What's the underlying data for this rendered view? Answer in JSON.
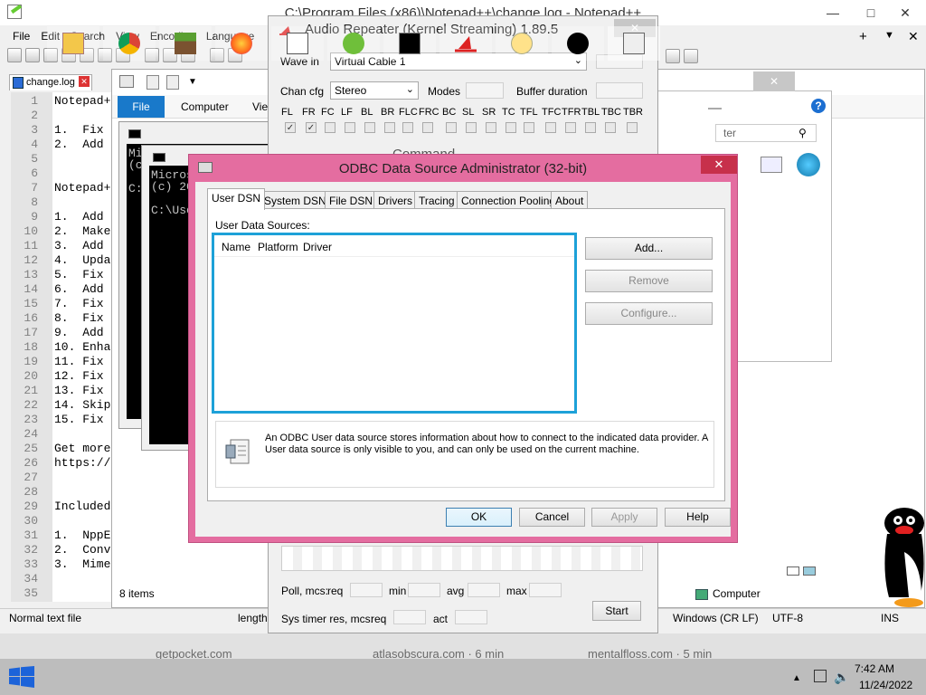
{
  "notepad": {
    "title": "C:\\Program Files (x86)\\Notepad++\\change.log - Notepad++",
    "menus": [
      "File",
      "Edit",
      "Search",
      "View",
      "Encoding",
      "Language"
    ],
    "tab": "change.log",
    "lines": [
      {
        "n": "1",
        "t": "Notepad++"
      },
      {
        "n": "2",
        "t": ""
      },
      {
        "n": "3",
        "t": "1.  Fix"
      },
      {
        "n": "4",
        "t": "2.  Add"
      },
      {
        "n": "5",
        "t": ""
      },
      {
        "n": "6",
        "t": ""
      },
      {
        "n": "7",
        "t": "Notepad++"
      },
      {
        "n": "8",
        "t": ""
      },
      {
        "n": "9",
        "t": "1.  Add"
      },
      {
        "n": "10",
        "t": "2.  Make"
      },
      {
        "n": "11",
        "t": "3.  Add"
      },
      {
        "n": "12",
        "t": "4.  Upda"
      },
      {
        "n": "13",
        "t": "5.  Fix"
      },
      {
        "n": "14",
        "t": "6.  Add"
      },
      {
        "n": "15",
        "t": "7.  Fix"
      },
      {
        "n": "16",
        "t": "8.  Fix"
      },
      {
        "n": "17",
        "t": "9.  Add"
      },
      {
        "n": "18",
        "t": "10. Enha"
      },
      {
        "n": "19",
        "t": "11. Fix"
      },
      {
        "n": "20",
        "t": "12. Fix"
      },
      {
        "n": "21",
        "t": "13. Fix"
      },
      {
        "n": "22",
        "t": "14. Skip"
      },
      {
        "n": "23",
        "t": "15. Fix"
      },
      {
        "n": "24",
        "t": ""
      },
      {
        "n": "25",
        "t": "Get more"
      },
      {
        "n": "26",
        "t": "https://"
      },
      {
        "n": "27",
        "t": ""
      },
      {
        "n": "28",
        "t": ""
      },
      {
        "n": "29",
        "t": "Included"
      },
      {
        "n": "30",
        "t": ""
      },
      {
        "n": "31",
        "t": "1.  NppE"
      },
      {
        "n": "32",
        "t": "2.  Conv"
      },
      {
        "n": "33",
        "t": "3.  Mime"
      },
      {
        "n": "34",
        "t": ""
      },
      {
        "n": "35",
        "t": ""
      }
    ],
    "status": {
      "type": "Normal text file",
      "length": "length",
      "eol": "Windows (CR LF)",
      "encoding": "UTF-8",
      "mode": "INS"
    }
  },
  "explorer": {
    "file_tab": "File",
    "computer_tab": "Computer",
    "view_tab": "Vie",
    "items_count_1": "8 items",
    "items_count_2": "8 items",
    "computer_label": "Computer",
    "search_placeholder": "ter"
  },
  "cmd": {
    "text1": "Mic\n(c\n\nC:",
    "text2": "Micros\n(c) 20\n\nC:\\Use"
  },
  "audio_repeater": {
    "title": "Audio Repeater (Kernel Streaming) 1.89.5",
    "wave_in_label": "Wave in",
    "wave_in_value": "Virtual Cable 1",
    "chan_cfg_label": "Chan cfg",
    "chan_cfg_value": "Stereo",
    "modes_label": "Modes",
    "buffer_label": "Buffer duration",
    "channels": [
      "FL",
      "FR",
      "FC",
      "LF",
      "BL",
      "BR",
      "FLC",
      "FRC",
      "BC",
      "SL",
      "SR",
      "TC",
      "TFL",
      "TFC",
      "TFR",
      "TBL",
      "TBC",
      "TBR"
    ],
    "checked": [
      true,
      true,
      false,
      false,
      false,
      false,
      false,
      false,
      false,
      false,
      false,
      false,
      false,
      false,
      false,
      false,
      false,
      false
    ],
    "behind_title": "Command Prompt",
    "poll_label": "Poll, mcs:",
    "req": "req",
    "min": "min",
    "avg": "avg",
    "max": "max",
    "sys_label": "Sys timer res, mcs:",
    "act": "act",
    "start_button": "Start"
  },
  "odbc": {
    "title": "ODBC Data Source Administrator (32-bit)",
    "tabs": [
      "User DSN",
      "System DSN",
      "File DSN",
      "Drivers",
      "Tracing",
      "Connection Pooling",
      "About"
    ],
    "sources_label": "User Data Sources:",
    "columns": [
      "Name",
      "Platform",
      "Driver"
    ],
    "add_button": "Add...",
    "remove_button": "Remove",
    "configure_button": "Configure...",
    "info_text": "An ODBC User data source stores information about how to connect to the indicated data provider.   A User data source is only visible to you, and can only be used on the current machine.",
    "ok": "OK",
    "cancel": "Cancel",
    "apply": "Apply",
    "help": "Help"
  },
  "taskbar": {
    "browser_tabs": [
      "getpocket.com",
      "atlasobscura.com · 6 min",
      "mentalfloss.com · 5 min"
    ],
    "time": "7:42 AM",
    "date": "11/24/2022"
  }
}
